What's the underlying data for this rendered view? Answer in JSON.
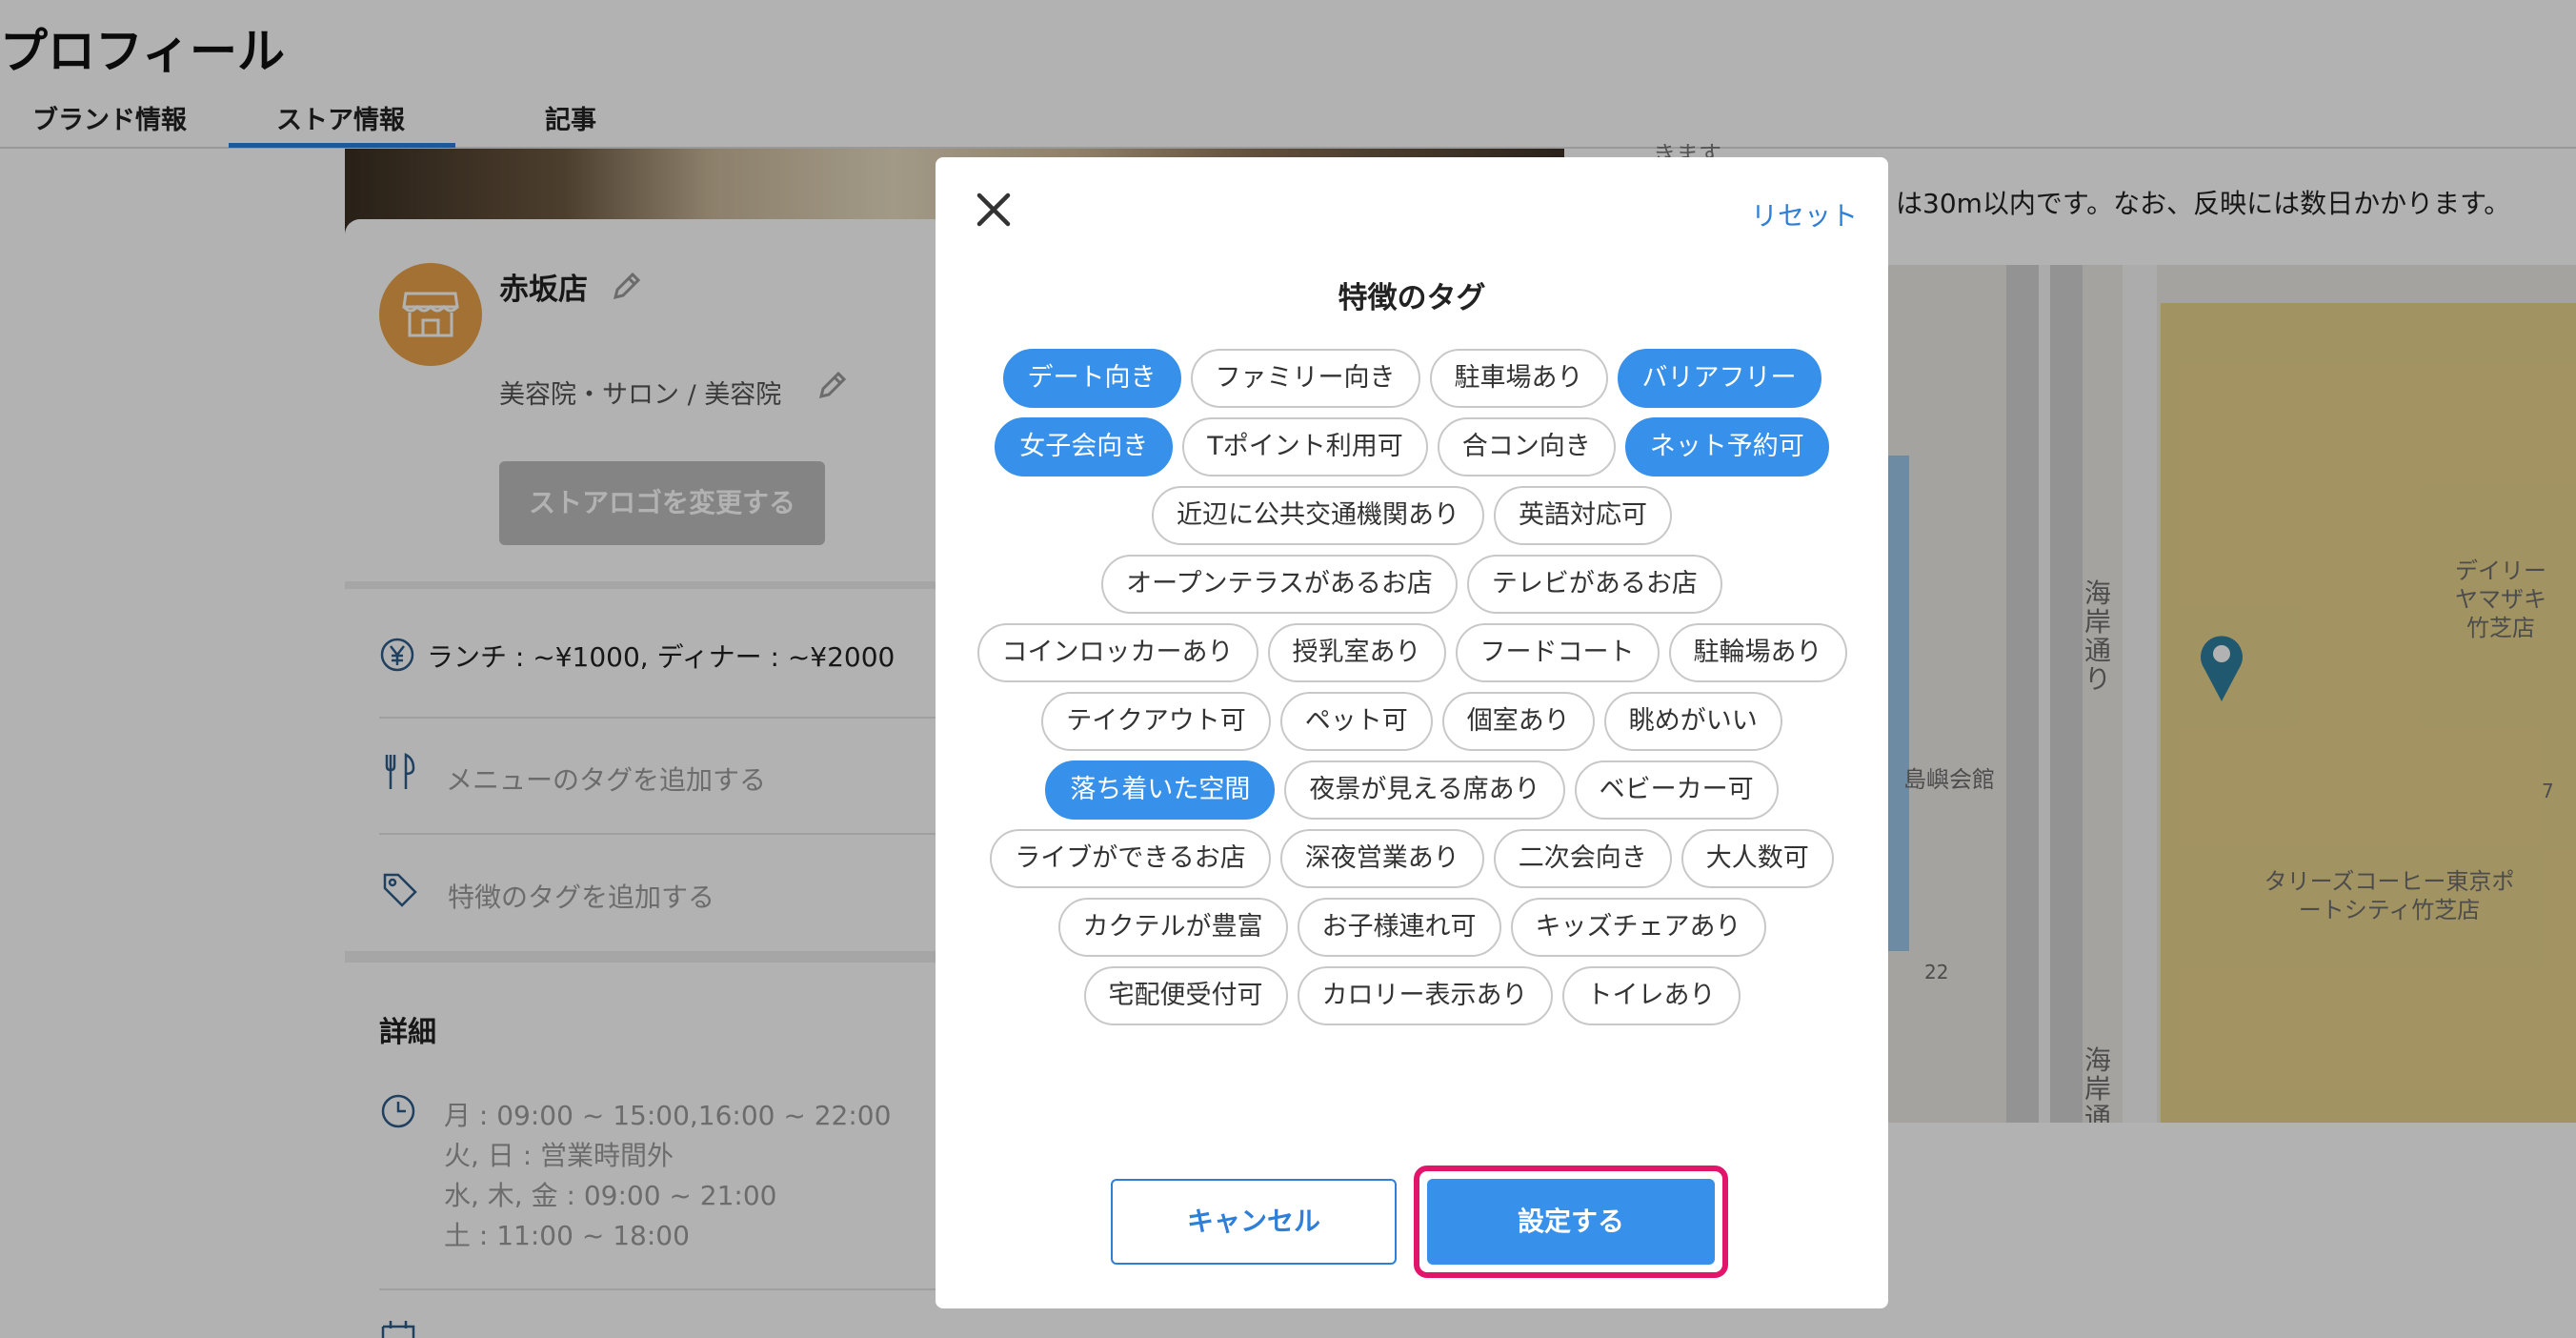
{
  "page": {
    "title": "プロフィール",
    "tabs": [
      "ブランド情報",
      "ストア情報",
      "記事"
    ],
    "active_tab": "ストア情報"
  },
  "store": {
    "name": "赤坂店",
    "category": "美容院・サロン / 美容院",
    "logo_button": "ストアロゴを変更する",
    "price": "ランチ : ~¥1000, ディナー : ~¥2000",
    "menu_tags_placeholder": "メニューのタグを追加する",
    "feature_tags_placeholder": "特徴のタグを追加する",
    "detail_title": "詳細",
    "hours": [
      "月 : 09:00 ~ 15:00,16:00 ~ 22:00",
      "火, 日 : 営業時間外",
      "水, 木, 金 : 09:00 ~ 21:00",
      "土 : 11:00 ~ 18:00"
    ]
  },
  "right": {
    "top_text": "きます",
    "note": "は30m以内です。なお、反映には数日かかります。"
  },
  "map": {
    "labels": {
      "road1": "海岸通り",
      "road2": "海岸通",
      "hall": "島嶼会館",
      "daily": "デイリーヤマザキ竹芝店",
      "tullys": "タリーズコーヒー東京ポートシティ竹芝店",
      "num22": "22",
      "num7": "7"
    },
    "pin_color": "#2f7fa0"
  },
  "modal": {
    "title": "特徴のタグ",
    "reset": "リセット",
    "cancel": "キャンセル",
    "submit": "設定する",
    "accent_color": "#3790ea",
    "highlight_color": "#e2156a",
    "tags": [
      {
        "label": "デート向き",
        "selected": true
      },
      {
        "label": "ファミリー向き",
        "selected": false
      },
      {
        "label": "駐車場あり",
        "selected": false
      },
      {
        "label": "バリアフリー",
        "selected": true
      },
      {
        "label": "女子会向き",
        "selected": true
      },
      {
        "label": "Tポイント利用可",
        "selected": false
      },
      {
        "label": "合コン向き",
        "selected": false
      },
      {
        "label": "ネット予約可",
        "selected": true
      },
      {
        "label": "近辺に公共交通機関あり",
        "selected": false
      },
      {
        "label": "英語対応可",
        "selected": false
      },
      {
        "label": "オープンテラスがあるお店",
        "selected": false
      },
      {
        "label": "テレビがあるお店",
        "selected": false
      },
      {
        "label": "コインロッカーあり",
        "selected": false
      },
      {
        "label": "授乳室あり",
        "selected": false
      },
      {
        "label": "フードコート",
        "selected": false
      },
      {
        "label": "駐輪場あり",
        "selected": false
      },
      {
        "label": "テイクアウト可",
        "selected": false
      },
      {
        "label": "ペット可",
        "selected": false
      },
      {
        "label": "個室あり",
        "selected": false
      },
      {
        "label": "眺めがいい",
        "selected": false
      },
      {
        "label": "落ち着いた空間",
        "selected": true
      },
      {
        "label": "夜景が見える席あり",
        "selected": false
      },
      {
        "label": "ベビーカー可",
        "selected": false
      },
      {
        "label": "ライブができるお店",
        "selected": false
      },
      {
        "label": "深夜営業あり",
        "selected": false
      },
      {
        "label": "二次会向き",
        "selected": false
      },
      {
        "label": "大人数可",
        "selected": false
      },
      {
        "label": "カクテルが豊富",
        "selected": false
      },
      {
        "label": "お子様連れ可",
        "selected": false
      },
      {
        "label": "キッズチェアあり",
        "selected": false
      },
      {
        "label": "宅配便受付可",
        "selected": false
      },
      {
        "label": "カロリー表示あり",
        "selected": false
      },
      {
        "label": "トイレあり",
        "selected": false
      }
    ]
  }
}
